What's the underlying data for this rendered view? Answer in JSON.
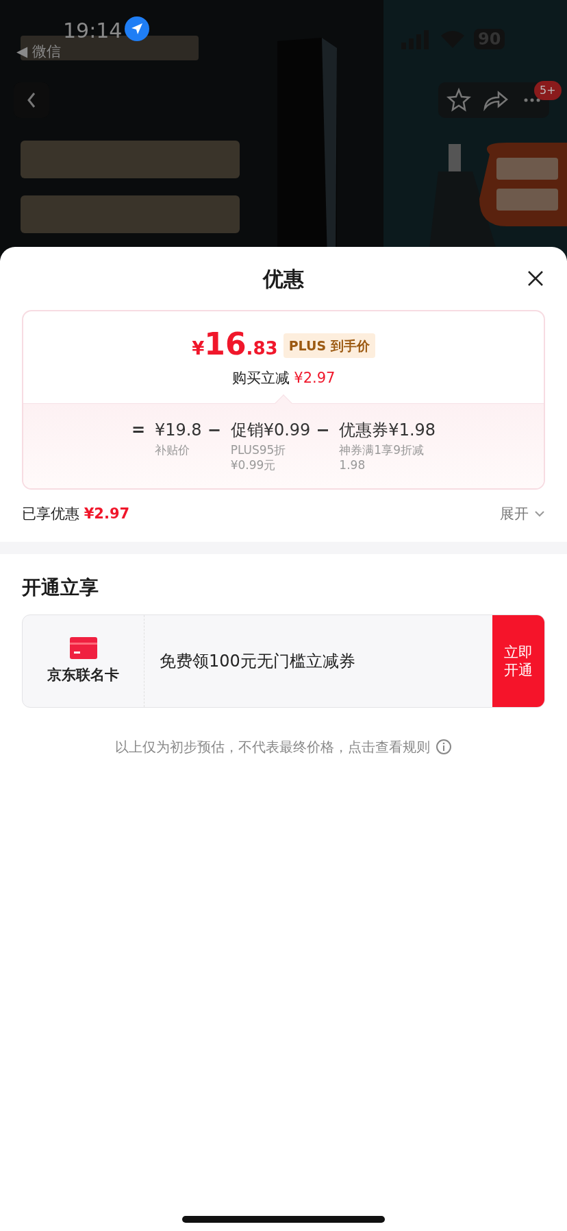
{
  "status_bar": {
    "time": "19:14",
    "back_app": "◀ 微信",
    "battery": "90"
  },
  "top_nav": {
    "badge": "5+"
  },
  "sheet": {
    "title": "优惠",
    "price": {
      "currency": "¥",
      "integer": "16",
      "decimal": ".83",
      "tag": "PLUS 到手价",
      "reduction_label": "购买立减",
      "reduction": "¥2.97"
    },
    "breakdown": [
      {
        "operator": "=",
        "amount": "¥19.8",
        "note_lines": [
          "补贴价"
        ]
      },
      {
        "operator": "−",
        "label": "促销",
        "amount": "¥0.99",
        "note_lines": [
          "PLUS95折",
          "¥0.99元"
        ]
      },
      {
        "operator": "−",
        "label": "优惠券",
        "amount": "¥1.98",
        "note_lines": [
          "神券满1享9折减",
          "1.98"
        ]
      }
    ],
    "enjoyed": {
      "label": "已享优惠",
      "amount": "¥2.97",
      "expand": "展开"
    },
    "open_section": {
      "title": "开通立享",
      "card_name": "京东联名卡",
      "offer": "免费领100元无门槛立减券",
      "button": "立即开通"
    },
    "footer_note": "以上仅为初步预估，不代表最终价格，点击查看规则"
  }
}
